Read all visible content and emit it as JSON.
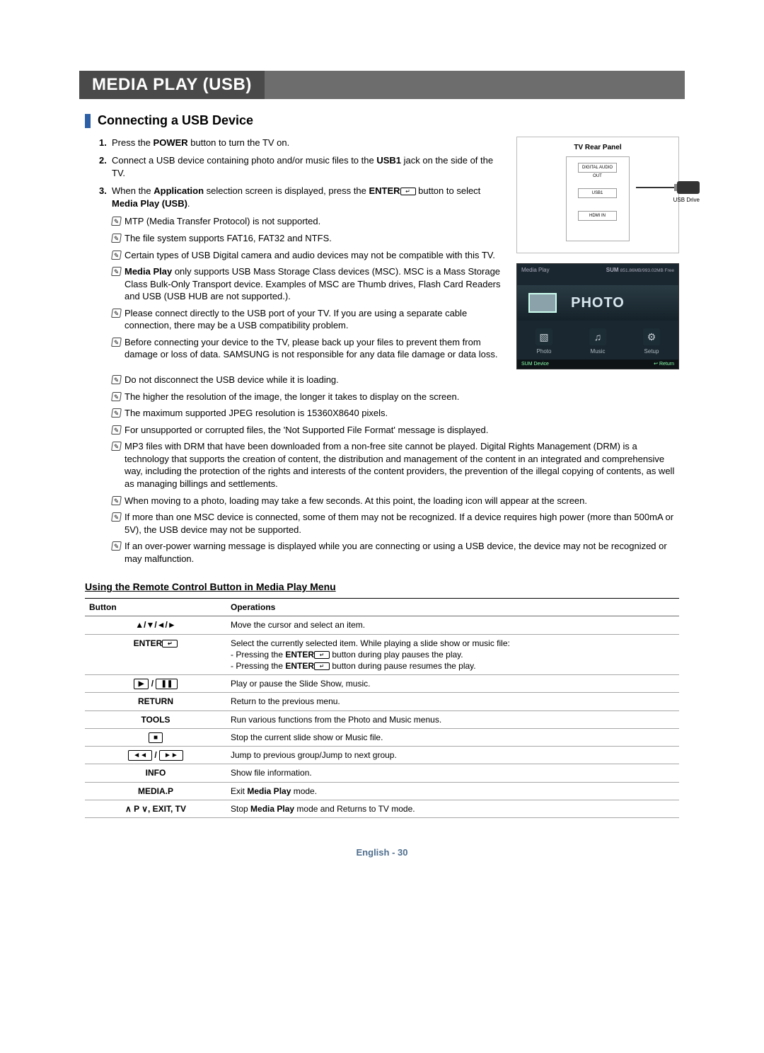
{
  "chapter": "MEDIA PLAY (USB)",
  "section": "Connecting a USB Device",
  "steps": {
    "s1": {
      "num": "1.",
      "text_a": "Press the ",
      "bold_a": "POWER",
      "text_b": " button to turn the TV on."
    },
    "s2": {
      "num": "2.",
      "text_a": "Connect a USB device containing photo and/or music files to the ",
      "bold_a": "USB1",
      "text_b": " jack on the side of the TV."
    },
    "s3": {
      "num": "3.",
      "text_a": "When the ",
      "bold_a": "Application",
      "text_b": " selection screen is displayed, press the ",
      "bold_b": "ENTER",
      "text_c": " button to select ",
      "bold_c": "Media Play (USB)",
      "text_d": "."
    }
  },
  "notes_col": {
    "n1": "MTP (Media Transfer Protocol) is not supported.",
    "n2": "The file system supports FAT16, FAT32 and NTFS.",
    "n3": "Certain types of USB Digital camera and audio devices may not be compatible with this TV.",
    "n4_a": "Media Play",
    "n4_b": " only supports USB Mass Storage Class devices (MSC). MSC is a Mass Storage Class Bulk-Only Transport device. Examples of MSC are Thumb drives, Flash Card Readers and USB (USB HUB are not supported.).",
    "n5": "Please connect directly to the USB port of your TV. If you are using a separate cable connection, there may be a USB compatibility problem.",
    "n6": "Before connecting your device to the TV, please back up your files to prevent them from damage or loss of data. SAMSUNG is not responsible for any data file damage or data loss."
  },
  "notes_full": {
    "f1": "Do not disconnect the USB device while it is loading.",
    "f2": "The higher the resolution of the image, the longer it takes to display on the screen.",
    "f3": "The maximum supported JPEG resolution is 15360X8640 pixels.",
    "f4": "For unsupported or corrupted files, the 'Not Supported File Format' message is displayed.",
    "f5": "MP3 files with DRM that have been downloaded from a non-free site cannot be played. Digital Rights Management (DRM) is a technology that supports the creation of content, the distribution and management of the content in an integrated and comprehensive way, including the protection of the rights and interests of the content providers, the prevention of the illegal copying of contents, as well as managing billings and settlements.",
    "f6": "When moving to a photo, loading may take a few seconds. At this point, the loading icon will appear at the screen.",
    "f7": "If more than one MSC device is connected, some of them may not be recognized. If a device requires high power (more than 500mA or 5V), the USB device may not be supported.",
    "f8": "If an over-power warning message is displayed while you are connecting or using a USB device, the device may not be recognized or may malfunction."
  },
  "panel": {
    "title": "TV Rear Panel",
    "usb_label": "USB Drive"
  },
  "screen": {
    "title": "Media Play",
    "sum": "SUM",
    "free": "851.86MB/993.02MB Free",
    "banner": "PHOTO",
    "item1": "Photo",
    "item2": "Music",
    "item3": "Setup",
    "foot_left": "SUM    Device",
    "foot_right": "Return"
  },
  "subsection": "Using the Remote Control Button in Media Play Menu",
  "table": {
    "h1": "Button",
    "h2": "Operations",
    "rows": [
      {
        "btn": "▲/▼/◄/►",
        "op": "Move the cursor and select an item."
      },
      {
        "btn": "ENTER",
        "icon": "↵",
        "op": "Select the currently selected item. While playing a slide show or music file:\n- Pressing the ENTER ↵ button during play pauses the play.\n- Pressing the ENTER ↵ button during pause resumes the play."
      },
      {
        "btn": "▶ / ❚❚",
        "boxed": true,
        "op": "Play or pause the Slide Show, music."
      },
      {
        "btn": "RETURN",
        "op": "Return to the previous menu."
      },
      {
        "btn": "TOOLS",
        "op": "Run various functions from the Photo and Music menus."
      },
      {
        "btn": "■",
        "boxed": true,
        "op": "Stop the current slide show or Music file."
      },
      {
        "btn": "◄◄ / ►►",
        "boxed": true,
        "op": "Jump to previous group/Jump to next group."
      },
      {
        "btn": "INFO",
        "op": "Show file information."
      },
      {
        "btn": "MEDIA.P",
        "op_a": "Exit ",
        "op_bold": "Media Play",
        "op_b": " mode."
      },
      {
        "btn": "∧ P ∨, EXIT, TV",
        "op_a": "Stop ",
        "op_bold": "Media Play",
        "op_b": " mode and Returns to TV mode."
      }
    ]
  },
  "footer": "English - 30",
  "enter_glyph": "↵"
}
